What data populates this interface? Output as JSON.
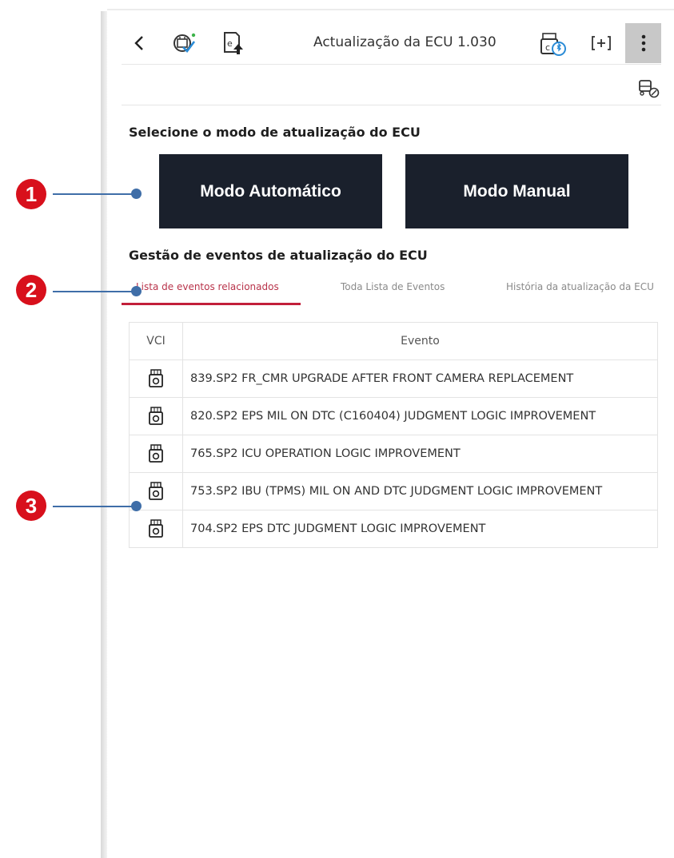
{
  "header": {
    "title": "Actualização da ECU 1.030",
    "icons": [
      "back-arrow-icon",
      "ecu-check-icon",
      "ecu-upload-icon",
      "vci-bluetooth-icon",
      "scan-add-icon",
      "more-vertical-icon",
      "vehicle-check-icon"
    ],
    "back_glyph": "<"
  },
  "mode_section": {
    "title": "Selecione o modo de atualização do ECU",
    "auto_label": "Modo Automático",
    "manual_label": "Modo Manual",
    "button_color": "#1a202c"
  },
  "events_section": {
    "title": "Gestão de eventos de atualização do ECU",
    "tabs": [
      {
        "label": "Lista de eventos relacionados",
        "active": true
      },
      {
        "label": "Toda Lista de Eventos",
        "active": false
      },
      {
        "label": "História da atualização da ECU",
        "active": false
      }
    ],
    "accent_color": "#c21f3a"
  },
  "table": {
    "headers": {
      "vci": "VCI",
      "event": "Evento"
    },
    "rows": [
      {
        "event": "839.SP2 FR_CMR UPGRADE AFTER FRONT CAMERA REPLACEMENT"
      },
      {
        "event": "820.SP2 EPS MIL ON DTC (C160404) JUDGMENT LOGIC IMPROVEMENT"
      },
      {
        "event": "765.SP2 ICU OPERATION LOGIC IMPROVEMENT"
      },
      {
        "event": "753.SP2 IBU (TPMS) MIL ON AND DTC JUDGMENT LOGIC IMPROVEMENT"
      },
      {
        "event": "704.SP2 EPS DTC JUDGMENT LOGIC IMPROVEMENT"
      }
    ]
  },
  "callouts": [
    {
      "label": "1"
    },
    {
      "label": "2"
    },
    {
      "label": "3"
    }
  ],
  "callout_color": "#d8101c",
  "callout_line_color": "#3f6ea8"
}
